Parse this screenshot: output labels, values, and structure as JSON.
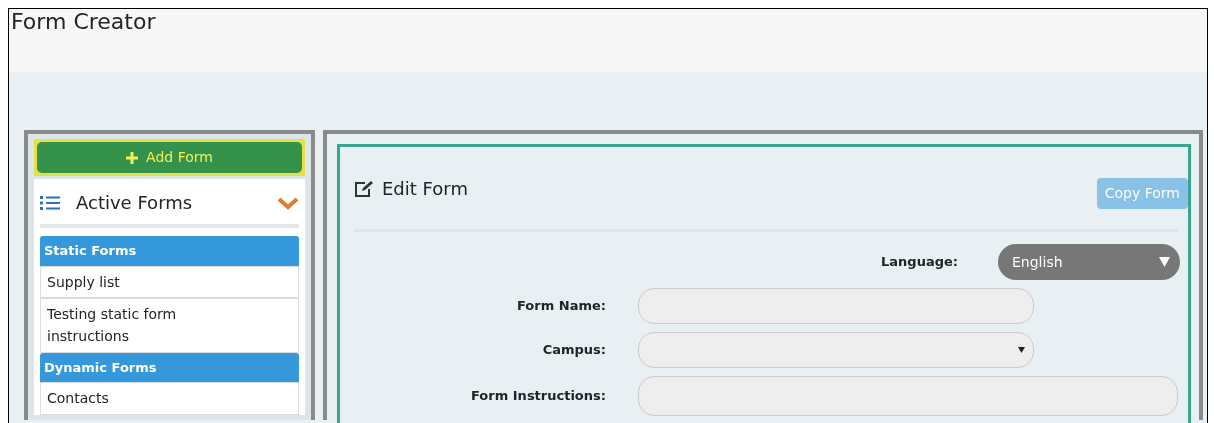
{
  "window": {
    "title": "Form Creator"
  },
  "sidebar": {
    "add_button": "Add Form",
    "heading": "Active Forms",
    "expanded": true,
    "groups": [
      {
        "label": "Static Forms",
        "items": [
          "Supply list",
          "Testing static form instructions"
        ]
      },
      {
        "label": "Dynamic Forms",
        "items": [
          "Contacts"
        ]
      }
    ]
  },
  "editor": {
    "title": "Edit Form",
    "copy_button": {
      "label": "Copy Form",
      "disabled": true
    },
    "language": {
      "label": "Language:",
      "value": "English"
    },
    "fields": [
      {
        "label": "Form Name:",
        "kind": "text"
      },
      {
        "label": "Campus:",
        "kind": "select"
      },
      {
        "label": "Form Instructions:",
        "kind": "textarea"
      }
    ]
  }
}
